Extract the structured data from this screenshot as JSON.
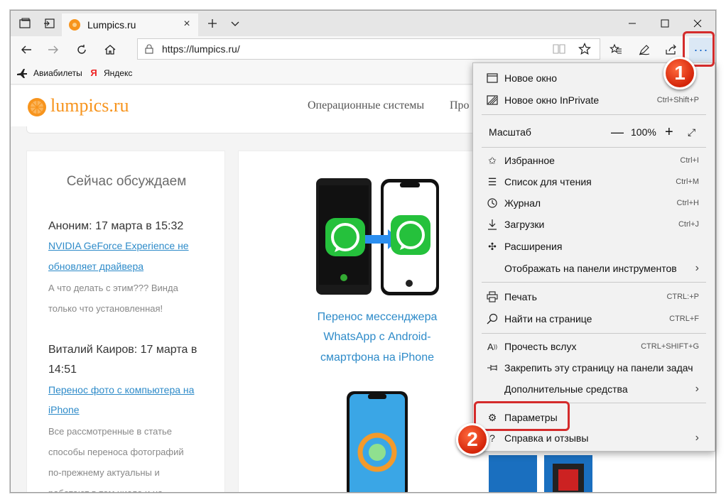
{
  "browser": {
    "tab_title": "Lumpics.ru",
    "url": "https://lumpics.ru/",
    "favorites": [
      {
        "label": "Авиабилеты"
      },
      {
        "label": "Яндекс"
      }
    ]
  },
  "site": {
    "logo": "lumpics.ru",
    "nav": [
      "Операционные системы",
      "Про"
    ],
    "sidebar_title": "Сейчас обсуждаем",
    "comments": [
      {
        "author": "Аноним: 17 марта в 15:32",
        "link": "NVIDIA GeForce Experience не обновляет драйвера",
        "link_lines": [
          "NVIDIA GeForce Experience не",
          "обновляет драйвера"
        ],
        "text_lines": [
          "А что делать с этим??? Винда",
          "только что установленная!"
        ]
      },
      {
        "author_lines": [
          "Виталий Каиров: 17 марта в",
          "14:51"
        ],
        "link_lines": [
          "Перенос фото с компьютера на",
          "iPhone"
        ],
        "text_lines": [
          "Все рассмотренные в статье",
          "способы переноса фотографий",
          "по-прежнему актуальны и",
          "работают в том числе и на"
        ]
      }
    ],
    "article_title_lines": [
      "Перенос мессенджера",
      "WhatsApp с Android-",
      "смартфона на iPhone"
    ]
  },
  "menu": {
    "items": [
      {
        "label": "Новое окно",
        "shortcut": ""
      },
      {
        "label": "Новое окно InPrivate",
        "shortcut": "Ctrl+Shift+P"
      },
      {
        "label": "Масштаб",
        "zoom": "100%"
      },
      {
        "label": "Избранное",
        "shortcut": "Ctrl+I"
      },
      {
        "label": "Список для чтения",
        "shortcut": "Ctrl+M"
      },
      {
        "label": "Журнал",
        "shortcut": "Ctrl+H"
      },
      {
        "label": "Загрузки",
        "shortcut": "Ctrl+J"
      },
      {
        "label": "Расширения",
        "shortcut": ""
      },
      {
        "label": "Отображать на панели инструментов",
        "shortcut": ""
      },
      {
        "label": "Печать",
        "shortcut": "CTRL:+P"
      },
      {
        "label": "Найти на странице",
        "shortcut": "CTRL+F"
      },
      {
        "label": "Прочесть вслух",
        "shortcut": "CTRL+SHIFT+G"
      },
      {
        "label": "Закрепить эту страницу на панели задач",
        "shortcut": ""
      },
      {
        "label": "Дополнительные средства",
        "shortcut": ""
      },
      {
        "label": "Параметры",
        "shortcut": ""
      },
      {
        "label": "Справка и отзывы",
        "shortcut": ""
      }
    ]
  },
  "annotations": {
    "badge1": "1",
    "badge2": "2"
  },
  "colors": {
    "accent": "#f7941d",
    "link": "#2e8bc9",
    "highlight": "#d42b2b"
  }
}
